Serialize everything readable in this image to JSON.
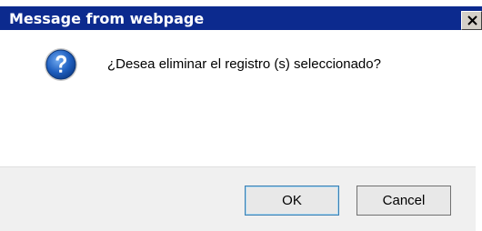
{
  "window": {
    "title": "Message from webpage",
    "close_label": "X"
  },
  "message": {
    "text": "¿Desea eliminar el registro (s) seleccionado?",
    "icon": "question-icon"
  },
  "buttons": {
    "ok_label": "OK",
    "cancel_label": "Cancel"
  },
  "colors": {
    "titlebar": "#0c2a8e",
    "content_bg": "#ffffff",
    "button_bar_bg": "#f0f0f0",
    "icon_blue": "#1f5fbf"
  }
}
